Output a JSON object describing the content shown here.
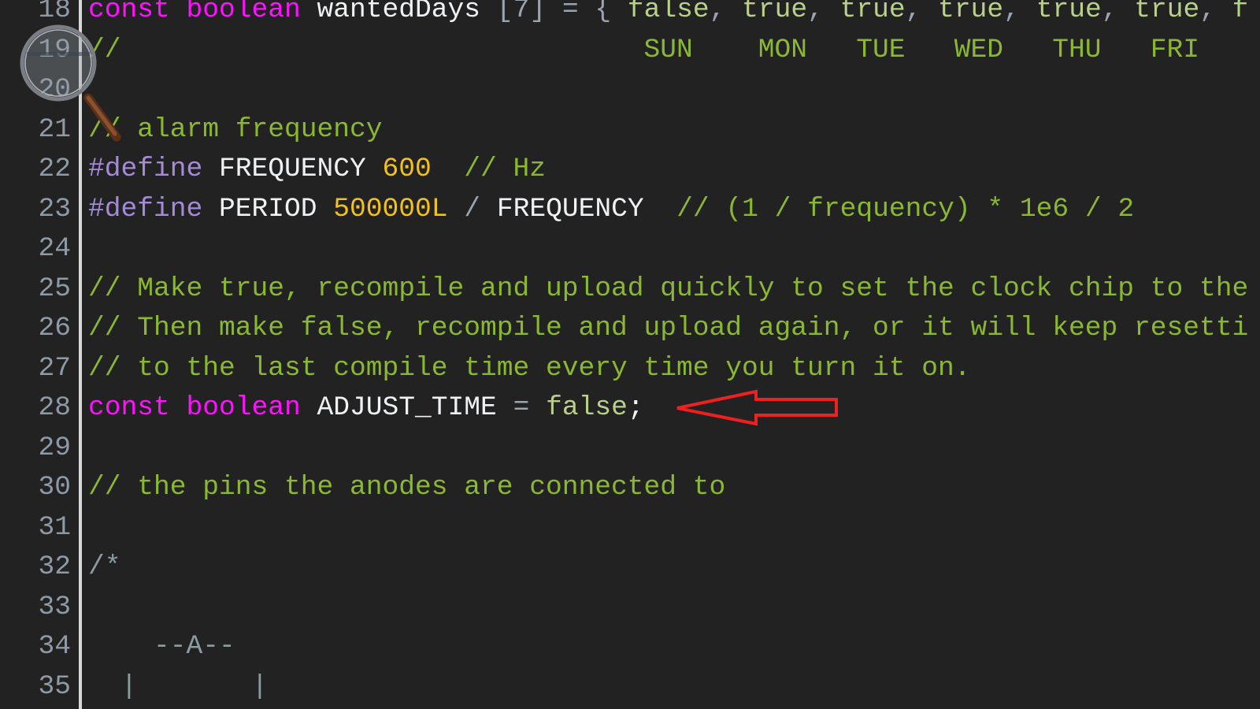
{
  "editor": {
    "colors": {
      "background": "#222222",
      "keyword": "#ff10ff",
      "preprocessor": "#a48ad8",
      "number": "#f2c21a",
      "comment": "#8ab830",
      "block_comment": "#8c9ca0",
      "annotation_arrow": "#ee2020"
    },
    "lines": [
      {
        "n": "18",
        "tokens": [
          {
            "t": "const",
            "c": "kw"
          },
          {
            "t": " "
          },
          {
            "t": "boolean",
            "c": "kw"
          },
          {
            "t": " wantedDays ",
            "c": "id"
          },
          {
            "t": "[7] = { ",
            "c": "op"
          },
          {
            "t": "false",
            "c": "lit"
          },
          {
            "t": ", ",
            "c": "op"
          },
          {
            "t": "true",
            "c": "lit"
          },
          {
            "t": ", ",
            "c": "op"
          },
          {
            "t": "true",
            "c": "lit"
          },
          {
            "t": ", ",
            "c": "op"
          },
          {
            "t": "true",
            "c": "lit"
          },
          {
            "t": ", ",
            "c": "op"
          },
          {
            "t": "true",
            "c": "lit"
          },
          {
            "t": ", ",
            "c": "op"
          },
          {
            "t": "true",
            "c": "lit"
          },
          {
            "t": ", ",
            "c": "op"
          },
          {
            "t": "f",
            "c": "lit"
          }
        ]
      },
      {
        "n": "19",
        "tokens": [
          {
            "t": "//                                SUN    MON   TUE   WED   THU   FRI",
            "c": "cm"
          }
        ]
      },
      {
        "n": "20",
        "tokens": []
      },
      {
        "n": "21",
        "tokens": [
          {
            "t": "// alarm frequency",
            "c": "cm"
          }
        ]
      },
      {
        "n": "22",
        "tokens": [
          {
            "t": "#define",
            "c": "pp"
          },
          {
            "t": " FREQUENCY ",
            "c": "id"
          },
          {
            "t": "600",
            "c": "num"
          },
          {
            "t": "  // Hz",
            "c": "cm"
          }
        ]
      },
      {
        "n": "23",
        "tokens": [
          {
            "t": "#define",
            "c": "pp"
          },
          {
            "t": " PERIOD ",
            "c": "id"
          },
          {
            "t": "500000L",
            "c": "num"
          },
          {
            "t": " / ",
            "c": "op"
          },
          {
            "t": "FREQUENCY",
            "c": "id"
          },
          {
            "t": "  // (1 / frequency) * 1e6 / 2",
            "c": "cm"
          }
        ]
      },
      {
        "n": "24",
        "tokens": []
      },
      {
        "n": "25",
        "tokens": [
          {
            "t": "// Make true, recompile and upload quickly to set the clock chip to the",
            "c": "cm"
          }
        ]
      },
      {
        "n": "26",
        "tokens": [
          {
            "t": "// Then make false, recompile and upload again, or it will keep resetti",
            "c": "cm"
          }
        ]
      },
      {
        "n": "27",
        "tokens": [
          {
            "t": "// to the last compile time every time you turn it on.",
            "c": "cm"
          }
        ]
      },
      {
        "n": "28",
        "tokens": [
          {
            "t": "const",
            "c": "kw"
          },
          {
            "t": " "
          },
          {
            "t": "boolean",
            "c": "kw"
          },
          {
            "t": " ADJUST_TIME ",
            "c": "id"
          },
          {
            "t": "= ",
            "c": "op"
          },
          {
            "t": "false",
            "c": "lit"
          },
          {
            "t": ";",
            "c": "id"
          }
        ]
      },
      {
        "n": "29",
        "tokens": []
      },
      {
        "n": "30",
        "tokens": [
          {
            "t": "// the pins the anodes are connected to",
            "c": "cm"
          }
        ]
      },
      {
        "n": "31",
        "tokens": []
      },
      {
        "n": "32",
        "tokens": [
          {
            "t": "/*",
            "c": "bc"
          }
        ]
      },
      {
        "n": "33",
        "tokens": []
      },
      {
        "n": "34",
        "tokens": [
          {
            "t": "    --A--",
            "c": "bc"
          }
        ]
      },
      {
        "n": "35",
        "tokens": [
          {
            "t": "  |       |",
            "c": "bc"
          }
        ]
      }
    ]
  }
}
